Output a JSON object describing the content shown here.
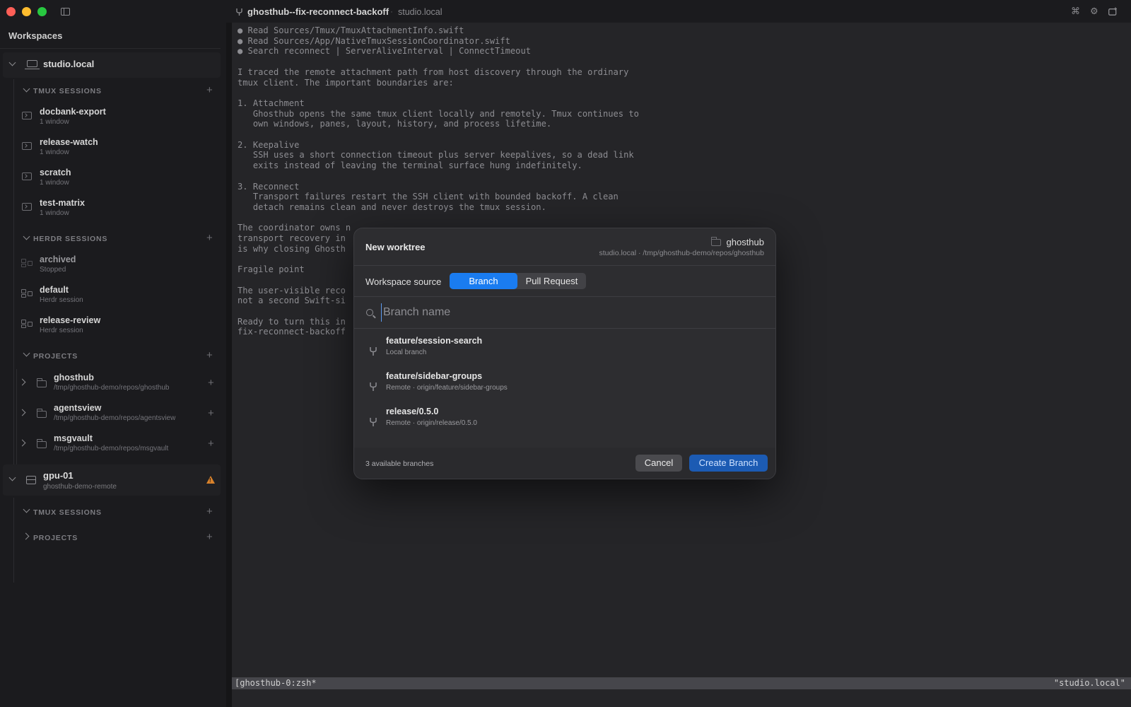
{
  "window": {
    "title": "ghosthub--fix-reconnect-backoff",
    "separator": "·",
    "host": "studio.local",
    "cmd_icon": "⌘",
    "gear_icon": "⚙"
  },
  "sidebar": {
    "heading": "Workspaces",
    "hosts": [
      {
        "name": "studio.local",
        "sections": [
          {
            "title": "TMUX SESSIONS",
            "items": [
              {
                "name": "docbank-export",
                "sub": "1 window"
              },
              {
                "name": "release-watch",
                "sub": "1 window"
              },
              {
                "name": "scratch",
                "sub": "1 window"
              },
              {
                "name": "test-matrix",
                "sub": "1 window"
              }
            ]
          },
          {
            "title": "HERDR SESSIONS",
            "items": [
              {
                "name": "archived",
                "sub": "Stopped"
              },
              {
                "name": "default",
                "sub": "Herdr session"
              },
              {
                "name": "release-review",
                "sub": "Herdr session"
              }
            ]
          },
          {
            "title": "PROJECTS",
            "items": [
              {
                "name": "ghosthub",
                "sub": "/tmp/ghosthub-demo/repos/ghosthub"
              },
              {
                "name": "agentsview",
                "sub": "/tmp/ghosthub-demo/repos/agentsview"
              },
              {
                "name": "msgvault",
                "sub": "/tmp/ghosthub-demo/repos/msgvault"
              }
            ]
          }
        ]
      },
      {
        "name": "gpu-01",
        "sub": "ghosthub-demo-remote",
        "warning": "!",
        "sections": [
          {
            "title": "TMUX SESSIONS"
          },
          {
            "title": "PROJECTS"
          }
        ]
      }
    ]
  },
  "terminal": {
    "lines": "● Read Sources/Tmux/TmuxAttachmentInfo.swift\n● Read Sources/App/NativeTmuxSessionCoordinator.swift\n● Search reconnect | ServerAliveInterval | ConnectTimeout\n\nI traced the remote attachment path from host discovery through the ordinary\ntmux client. The important boundaries are:\n\n1. Attachment\n   Ghosthub opens the same tmux client locally and remotely. Tmux continues to\n   own windows, panes, layout, history, and process lifetime.\n\n2. Keepalive\n   SSH uses a short connection timeout plus server keepalives, so a dead link\n   exits instead of leaving the terminal surface hung indefinitely.\n\n3. Reconnect\n   Transport failures restart the SSH client with bounded backoff. A clean\n   detach remains clean and never destroys the tmux session.\n\nThe coordinator owns n\ntransport recovery in\nis why closing Ghosth\n\nFragile point\n\nThe user-visible reco\nnot a second Swift-si\n\nReady to turn this in\nfix-reconnect-backoff",
    "status_left": "[ghosthub-0:zsh*",
    "status_right": "\"studio.local\""
  },
  "modal": {
    "title": "New worktree",
    "project_name": "ghosthub",
    "project_path": "studio.local · /tmp/ghosthub-demo/repos/ghosthub",
    "source_label": "Workspace source",
    "source_options": [
      "Branch",
      "Pull Request"
    ],
    "source_selected": "Branch",
    "search_placeholder": "Branch name",
    "search_value": "",
    "branches": [
      {
        "name": "feature/session-search",
        "sub": "Local branch"
      },
      {
        "name": "feature/sidebar-groups",
        "sub": "Remote · origin/feature/sidebar-groups"
      },
      {
        "name": "release/0.5.0",
        "sub": "Remote · origin/release/0.5.0"
      }
    ],
    "count_text": "3 available branches",
    "cancel_label": "Cancel",
    "create_label": "Create Branch"
  },
  "colors": {
    "accent": "#1a7cf0",
    "create_button": "#1c5bb3",
    "warning": "#d9822b",
    "close": "#fe5f57",
    "minimize": "#febc2e",
    "zoom": "#28c840"
  }
}
